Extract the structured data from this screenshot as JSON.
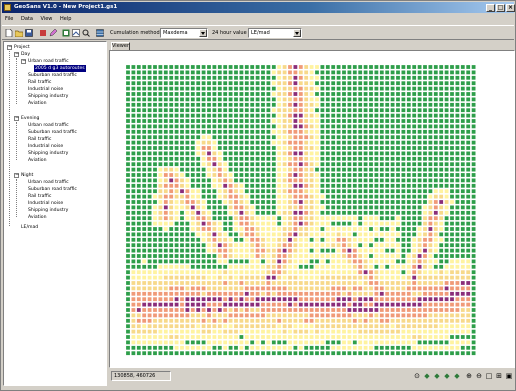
{
  "window": {
    "title": "GeoSans V1.0 - New Project1.gs1"
  },
  "menu": [
    "File",
    "Data",
    "View",
    "Help"
  ],
  "toolbar": {
    "calc_label": "Cumulation method",
    "calc_value": "Maxdema",
    "hour_label": "24 hour value",
    "hour_value": "LE/mad"
  },
  "tree": {
    "root": "Project",
    "groups": [
      {
        "label": "Day",
        "items": [
          "Urban road traffic",
          "2005 d g3 autoroutes",
          "Suburban road traffic",
          "Rail traffic",
          "Industrial noise",
          "Shipping industry",
          "Aviation"
        ]
      },
      {
        "label": "Evening",
        "items": [
          "Urban road traffic",
          "Suburban road traffic",
          "Rail traffic",
          "Industrial noise",
          "Shipping industry",
          "Aviation"
        ]
      },
      {
        "label": "Night",
        "items": [
          "Urban road traffic",
          "Suburban road traffic",
          "Rail traffic",
          "Industrial noise",
          "Shipping industry",
          "Aviation"
        ]
      }
    ],
    "leaf": "LE/mad"
  },
  "viewer": {
    "tab": "Viewer"
  },
  "status": {
    "coords": "130858, 460726"
  },
  "colors": {
    "background_green": "#2e9e4a",
    "low": "#fff3a0",
    "mid": "#f7d98a",
    "high": "#f09a78",
    "peak": "#8a2d7a"
  }
}
